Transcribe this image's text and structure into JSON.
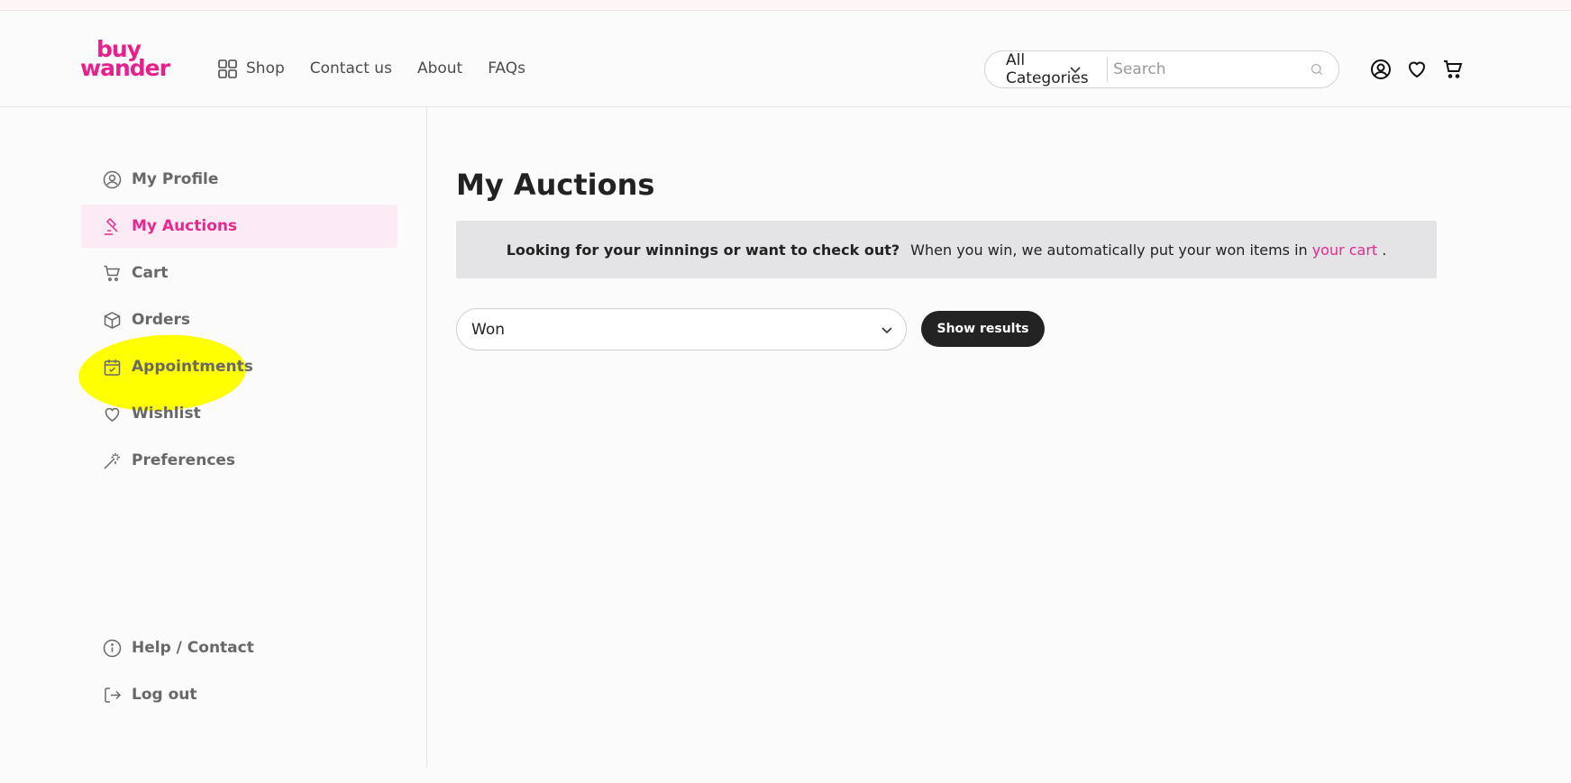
{
  "brand": {
    "line1": "buy",
    "line2": "wander",
    "color": "#ea1e8c"
  },
  "nav": {
    "shop": "Shop",
    "contact": "Contact us",
    "about": "About",
    "faqs": "FAQs"
  },
  "search": {
    "category": "All Categories",
    "placeholder": "Search"
  },
  "header_icons": [
    "account-icon",
    "wishlist-heart-icon",
    "cart-icon"
  ],
  "sidebar": {
    "items": [
      {
        "label": "My Profile",
        "icon": "user-circle-icon"
      },
      {
        "label": "My Auctions",
        "icon": "gavel-icon",
        "active": true
      },
      {
        "label": "Cart",
        "icon": "cart-icon"
      },
      {
        "label": "Orders",
        "icon": "box-icon"
      },
      {
        "label": "Appointments",
        "icon": "calendar-check-icon"
      },
      {
        "label": "Wishlist",
        "icon": "heart-icon"
      },
      {
        "label": "Preferences",
        "icon": "magic-wand-icon"
      }
    ],
    "footer": [
      {
        "label": "Help / Contact",
        "icon": "info-icon"
      },
      {
        "label": "Log out",
        "icon": "logout-icon"
      }
    ]
  },
  "main": {
    "title": "My Auctions",
    "notice": {
      "bold": "Looking for your winnings or want to check out?",
      "text": "When you win, we automatically put your won items in",
      "link": "your cart",
      "end": "."
    },
    "filter": {
      "selected": "Won"
    },
    "show_button": "Show results"
  },
  "colors": {
    "accent": "#e8278f",
    "active_bg": "#fcebf4",
    "highlight": "#ffff00",
    "button": "#232323"
  }
}
